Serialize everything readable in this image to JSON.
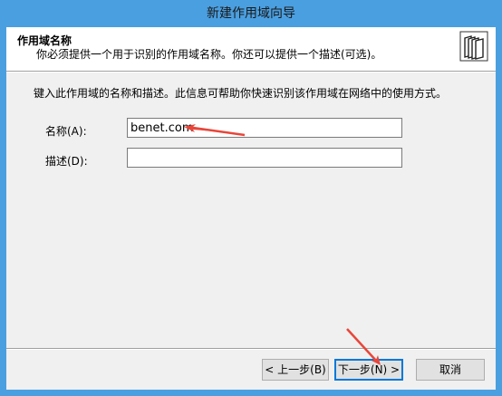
{
  "window": {
    "title": "新建作用域向导"
  },
  "header": {
    "title": "作用域名称",
    "subtitle": "你必须提供一个用于识别的作用域名称。你还可以提供一个描述(可选)。",
    "icon": "book-icon"
  },
  "main": {
    "instruction": "键入此作用域的名称和描述。此信息可帮助你快速识别该作用域在网络中的使用方式。",
    "name_label": "名称(A):",
    "name_value": "benet.com",
    "description_label": "描述(D):",
    "description_value": ""
  },
  "buttons": {
    "back": "< 上一步(B)",
    "next": "下一步(N) >",
    "cancel": "取消"
  },
  "colors": {
    "arrow": "#e8463a",
    "titlebar": "#4a9fe0"
  }
}
